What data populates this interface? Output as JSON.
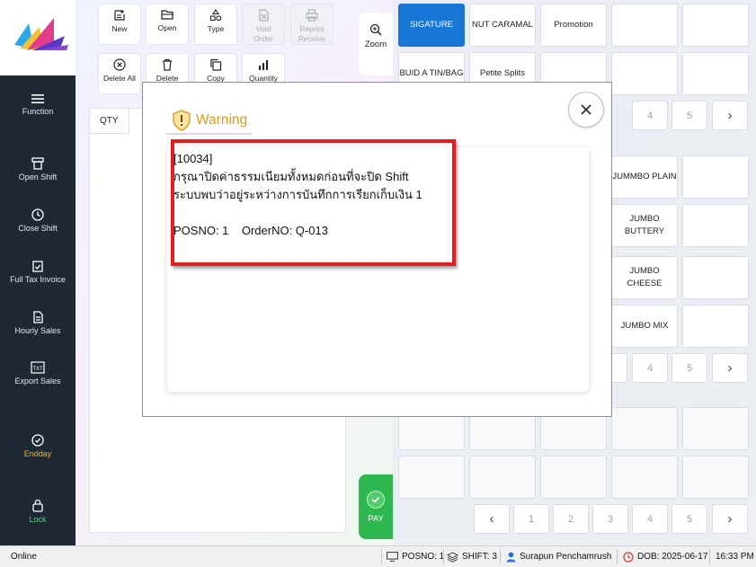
{
  "toolbar": {
    "row1": [
      {
        "label": "New",
        "icon": "new-order-icon",
        "enabled": true
      },
      {
        "label": "Open",
        "icon": "folder-open-icon",
        "enabled": true
      },
      {
        "label": "Type",
        "icon": "shapes-icon",
        "enabled": true
      },
      {
        "label": "Void\nOrder",
        "icon": "void-order-icon",
        "enabled": false
      },
      {
        "label": "Reprint\nReceive",
        "icon": "printer-icon",
        "enabled": false
      }
    ],
    "row2": [
      {
        "label": "Delete All",
        "icon": "close-circle-icon"
      },
      {
        "label": "Delete",
        "icon": "trash-icon"
      },
      {
        "label": "Copy",
        "icon": "copy-icon"
      },
      {
        "label": "Quantity",
        "icon": "bar-chart-icon"
      }
    ],
    "zoom_label": "Zoom"
  },
  "sidebar": [
    {
      "label": "Function",
      "icon": "menu-icon"
    },
    {
      "label": "Open Shift",
      "icon": "register-icon"
    },
    {
      "label": "Close Shift",
      "icon": "clock-icon"
    },
    {
      "label": "Full Tax Invoice",
      "icon": "clipboard-check-icon"
    },
    {
      "label": "Hourly Sales",
      "icon": "document-icon"
    },
    {
      "label": "Export Sales",
      "icon": "txt-file-icon"
    },
    {
      "label": "Endday",
      "icon": "check-circle-icon"
    },
    {
      "label": "Lock",
      "icon": "lock-icon"
    }
  ],
  "order": {
    "qty_header": "QTY"
  },
  "pay": {
    "label": "PAY"
  },
  "categories": [
    "SIGATURE",
    "NUT CARAMAL",
    "Promotion",
    "",
    "",
    "BUID A TIN/BAG",
    "Petite Splits",
    "",
    "",
    ""
  ],
  "products": [
    "JUMMBO PLAIN",
    "JUMBO BUTTERY",
    "JUMBO CHEESE",
    "JUMBO MIX"
  ],
  "pagers": {
    "categories": [
      "4",
      "5"
    ],
    "products": [
      "4",
      "5"
    ],
    "bottom": [
      "1",
      "2",
      "3",
      "4",
      "5"
    ]
  },
  "dialog": {
    "title": "Warning",
    "lines": [
      "[10034]",
      "กรุณาปิดค่าธรรมเนียมทั้งหมดก่อนที่จะปิด Shift",
      "ระบบพบว่าอยู่ระหว่างการบันทึกการเรียกเก็บเงิน 1",
      "",
      "POSNO: 1    OrderNO: Q-013"
    ]
  },
  "status": {
    "connection": "Online",
    "posno": "POSNO: 1",
    "shift": "SHIFT: 3",
    "user": "Surapun Penchamrush",
    "dob": "DOB: 2025-06-17",
    "time": "16:33 PM"
  },
  "colors": {
    "selected": "#1877d6",
    "pay": "#2fb84f",
    "warning": "#e09a17",
    "highlight": "#e41c1c",
    "sidebar": "#1f2935"
  }
}
